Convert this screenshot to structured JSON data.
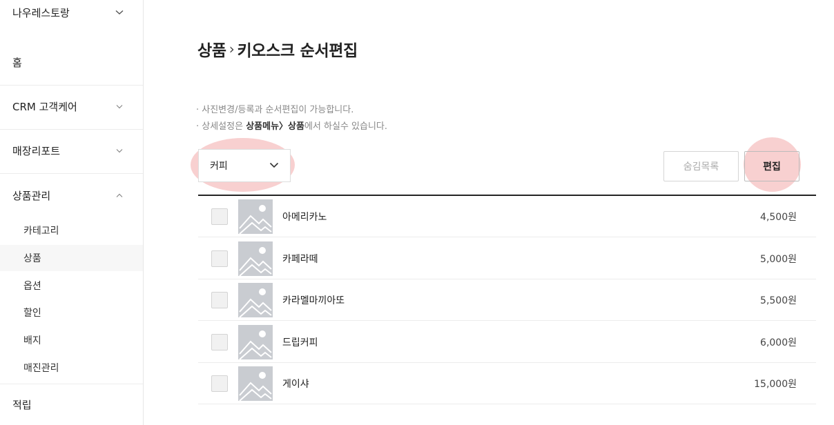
{
  "sidebar": {
    "store_name": "나우레스토랑",
    "home": "홈",
    "crm": "CRM 고객케어",
    "report": "매장리포트",
    "product_mgmt": "상품관리",
    "sub_items": [
      {
        "label": "카테고리",
        "active": false
      },
      {
        "label": "상품",
        "active": true
      },
      {
        "label": "옵션",
        "active": false
      },
      {
        "label": "할인",
        "active": false
      },
      {
        "label": "배지",
        "active": false
      },
      {
        "label": "매진관리",
        "active": false
      }
    ],
    "points": "적립"
  },
  "header": {
    "crumb_parent": "상품",
    "crumb_separator": "›",
    "crumb_current": "키오스크 순서편집"
  },
  "notes": {
    "line1": "· 사진변경/등록과 순서편집이 가능합니다.",
    "line2_prefix": "· 상세설정은 ",
    "line2_bold": "상품메뉴〉상품",
    "line2_suffix": "에서 하실수 있습니다."
  },
  "category_select": {
    "value": "커피"
  },
  "buttons": {
    "hidden_list": "숨김목록",
    "edit": "편집"
  },
  "products": [
    {
      "name": "아메리카노",
      "price": "4,500원"
    },
    {
      "name": "카페라떼",
      "price": "5,000원"
    },
    {
      "name": "카라멜마끼아또",
      "price": "5,500원"
    },
    {
      "name": "드립커피",
      "price": "6,000원"
    },
    {
      "name": "게이샤",
      "price": "15,000원"
    }
  ],
  "colors": {
    "highlight": "#f09696",
    "thumb_placeholder": "#c9ccd1"
  }
}
